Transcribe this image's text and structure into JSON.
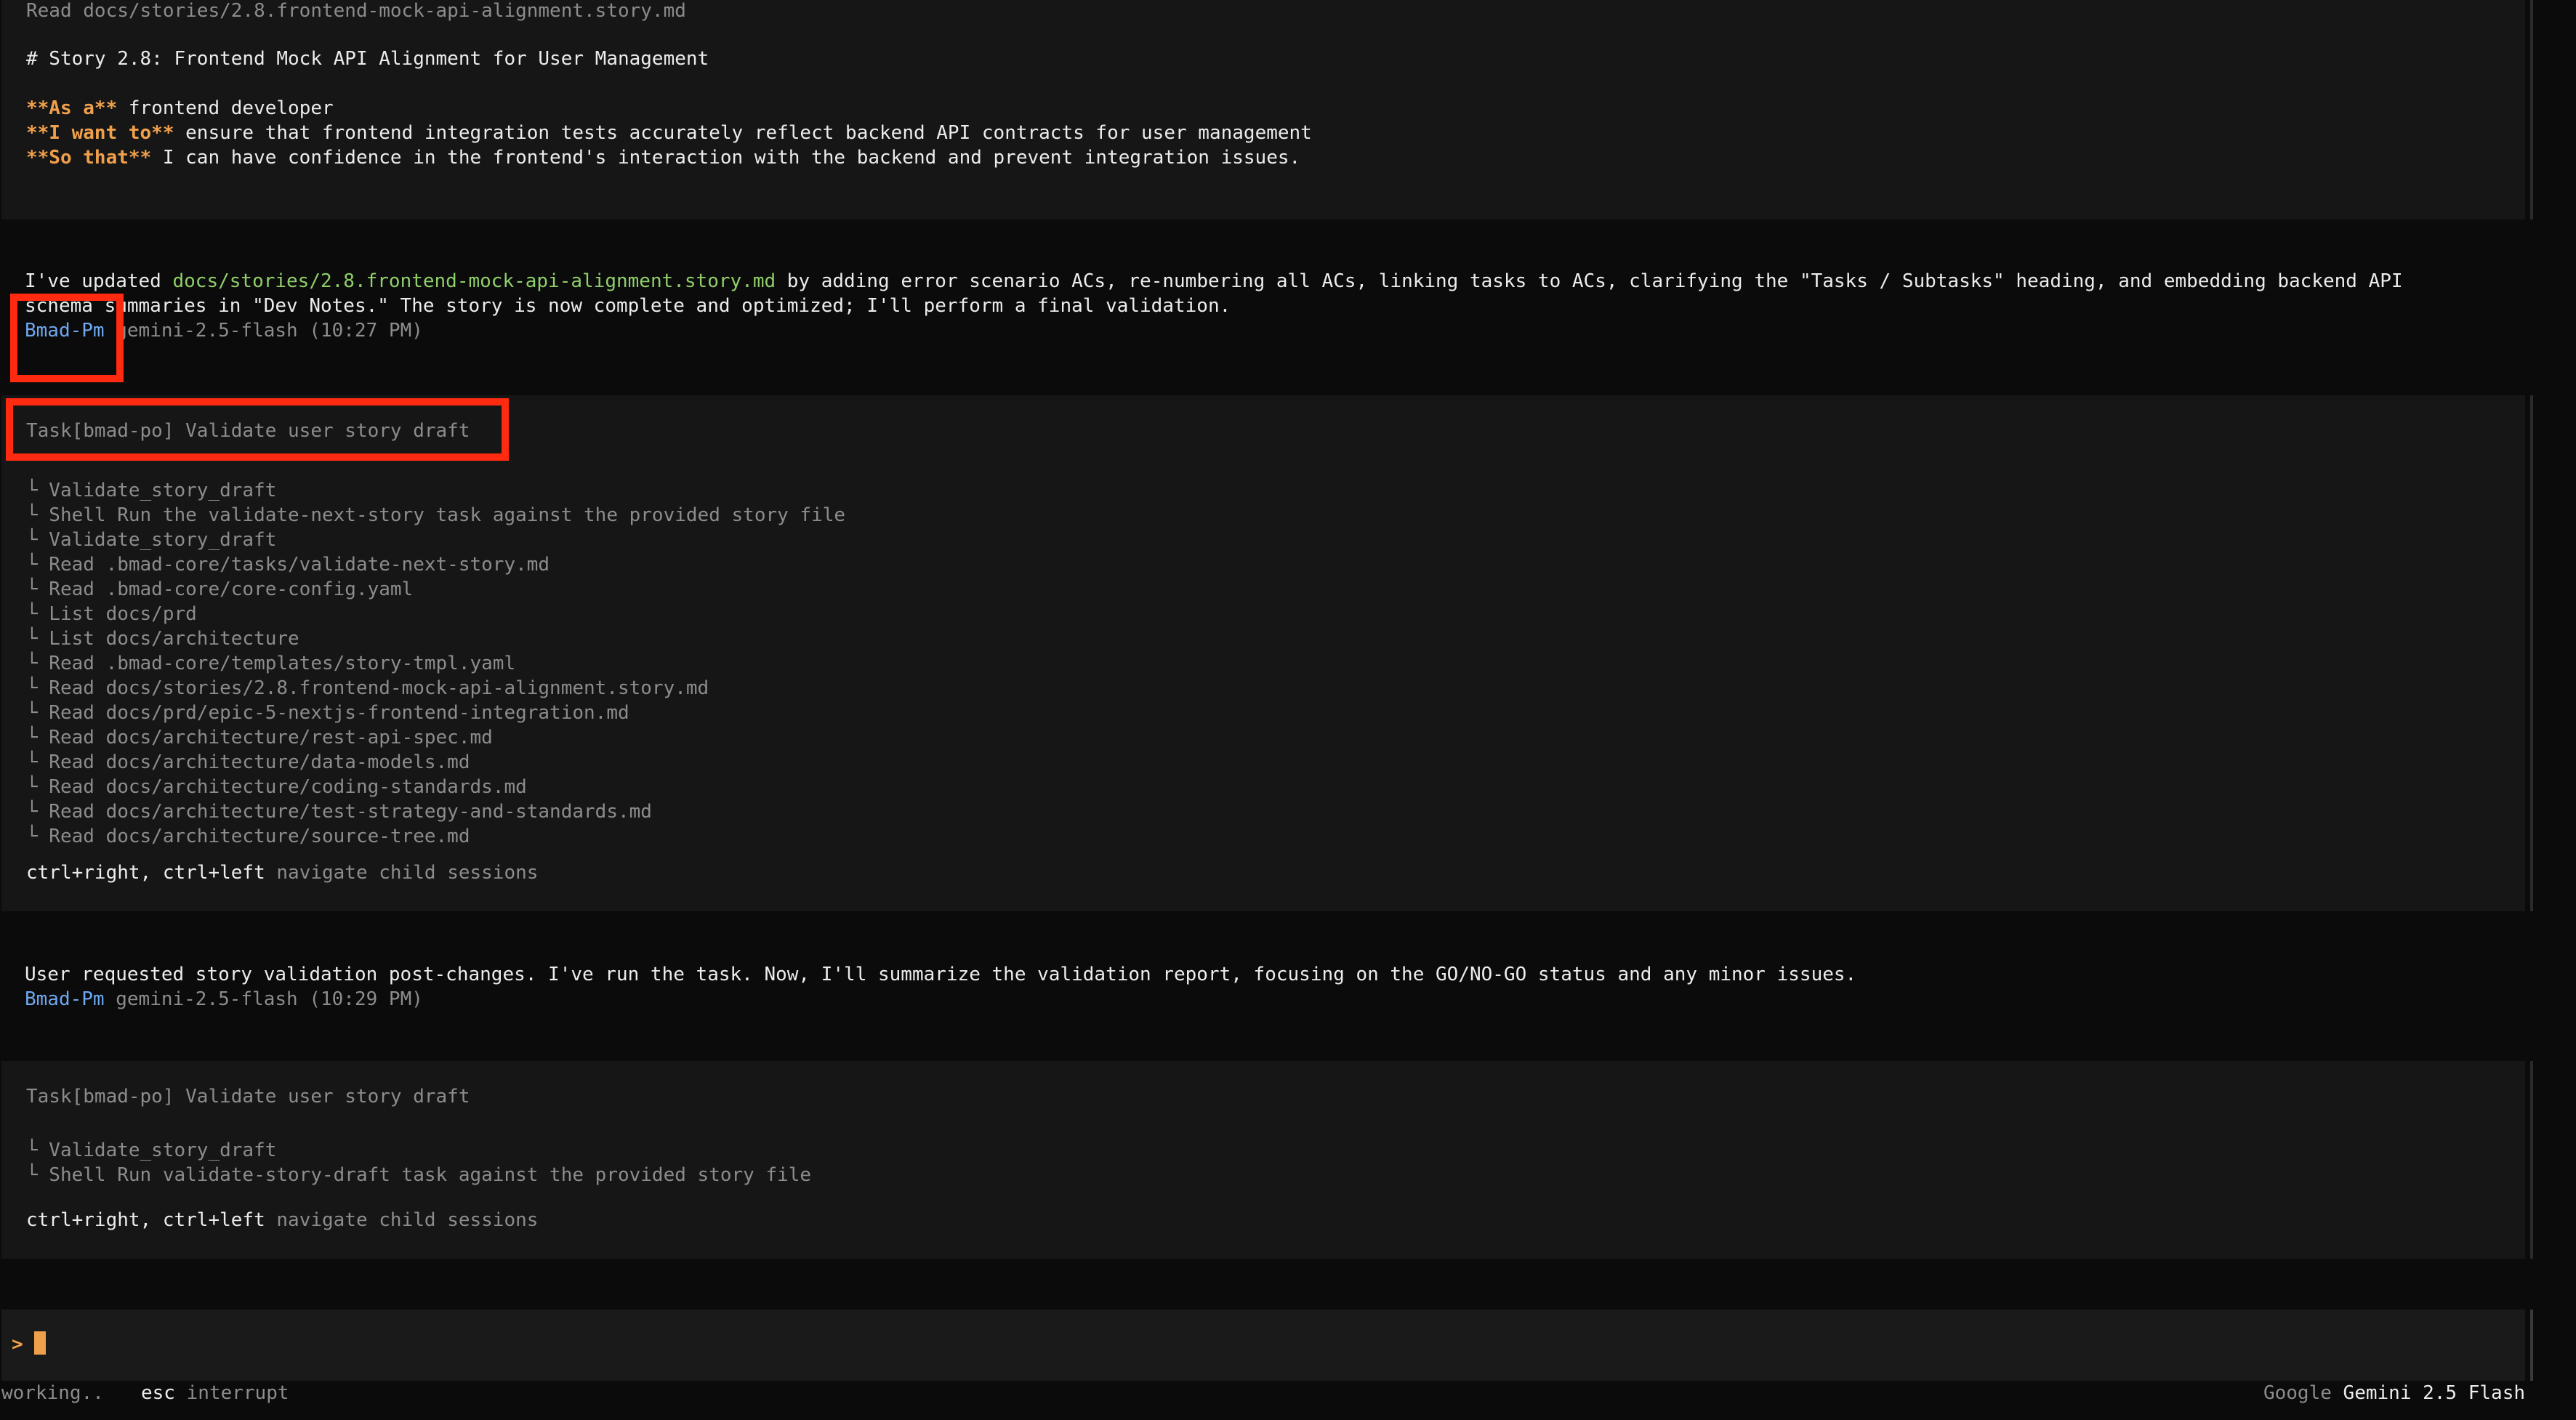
{
  "block1": {
    "read_line": "Read docs/stories/2.8.frontend-mock-api-alignment.story.md",
    "heading": "# Story 2.8: Frontend Mock API Alignment for User Management",
    "as_a_label": "**As a**",
    "as_a_text": " frontend developer",
    "i_want_label": "**I want to**",
    "i_want_text": " ensure that frontend integration tests accurately reflect backend API contracts for user management",
    "so_that_label": "**So that**",
    "so_that_text": " I can have confidence in the frontend's interaction with the backend and prevent integration issues."
  },
  "message1": {
    "pre": "I've updated ",
    "file": "docs/stories/2.8.frontend-mock-api-alignment.story.md",
    "post": " by adding error scenario ACs, re-numbering all ACs, linking tasks to ACs, clarifying the \"Tasks / Subtasks\" heading, and embedding backend API",
    "line2": "schema summaries in \"Dev Notes.\" The story is now complete and optimized; I'll perform a final validation.",
    "agent": "Bmad-Pm",
    "model": " gemini-2.5-flash (10:27 PM)"
  },
  "task1": {
    "title": "Task[bmad-po] Validate user story draft",
    "items": [
      "└ Validate_story_draft",
      "└ Shell Run the validate-next-story task against the provided story file",
      "└ Validate_story_draft",
      "└ Read .bmad-core/tasks/validate-next-story.md",
      "└ Read .bmad-core/core-config.yaml",
      "└ List docs/prd",
      "└ List docs/architecture",
      "└ Read .bmad-core/templates/story-tmpl.yaml",
      "└ Read docs/stories/2.8.frontend-mock-api-alignment.story.md",
      "└ Read docs/prd/epic-5-nextjs-frontend-integration.md",
      "└ Read docs/architecture/rest-api-spec.md",
      "└ Read docs/architecture/data-models.md",
      "└ Read docs/architecture/coding-standards.md",
      "└ Read docs/architecture/test-strategy-and-standards.md",
      "└ Read docs/architecture/source-tree.md"
    ],
    "keys": "ctrl+right, ctrl+left",
    "hint": " navigate child sessions"
  },
  "message2": {
    "text": "User requested story validation post-changes. I've run the task. Now, I'll summarize the validation report, focusing on the GO/NO-GO status and any minor issues.",
    "agent": "Bmad-Pm",
    "model": " gemini-2.5-flash (10:29 PM)"
  },
  "task2": {
    "title": "Task[bmad-po] Validate user story draft",
    "items": [
      "└ Validate_story_draft",
      "└ Shell Run validate-story-draft task against the provided story file"
    ],
    "keys": "ctrl+right, ctrl+left",
    "hint": " navigate child sessions"
  },
  "input": {
    "prompt": ">"
  },
  "status": {
    "working": "working..",
    "esc_key": "esc",
    "esc_hint": " interrupt",
    "provider": "Google",
    "model": "Gemini 2.5 Flash"
  },
  "colors": {
    "background": "#0b0b0b",
    "panel": "#161616",
    "accent_orange": "#f0a04b",
    "link_green": "#8fcf6a",
    "agent_blue": "#6ea8f0",
    "highlight_red": "#ff2a10"
  }
}
